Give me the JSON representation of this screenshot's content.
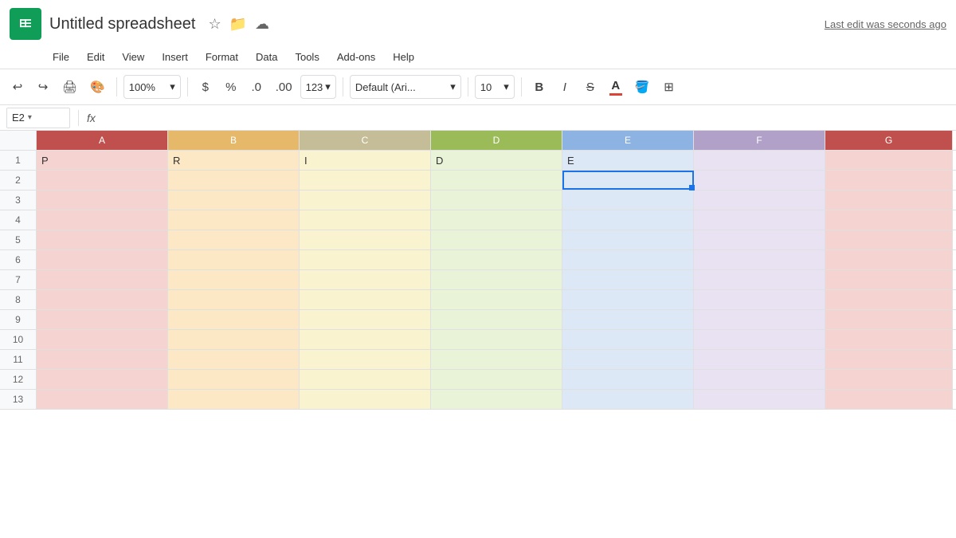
{
  "titleBar": {
    "title": "Untitled spreadsheet",
    "lastEdit": "Last edit was seconds ago"
  },
  "menu": {
    "items": [
      "File",
      "Edit",
      "View",
      "Insert",
      "Format",
      "Data",
      "Tools",
      "Add-ons",
      "Help"
    ]
  },
  "toolbar": {
    "zoom": "100%",
    "currency": "$",
    "percent": "%",
    "decimal0": ".0",
    "decimal00": ".00",
    "moreFormats": "123",
    "font": "Default (Ari...",
    "fontSize": "10",
    "bold": "B",
    "italic": "I",
    "strikethrough": "S",
    "underlineA": "A"
  },
  "formulaBar": {
    "cellRef": "E2",
    "fx": "fx"
  },
  "columns": [
    {
      "id": "A",
      "label": "A",
      "width": 165
    },
    {
      "id": "B",
      "label": "B",
      "width": 165
    },
    {
      "id": "C",
      "label": "C",
      "width": 165
    },
    {
      "id": "D",
      "label": "D",
      "width": 165
    },
    {
      "id": "E",
      "label": "E",
      "width": 165
    },
    {
      "id": "F",
      "label": "F",
      "width": 165
    },
    {
      "id": "G",
      "label": "G",
      "width": 160
    }
  ],
  "rows": [
    {
      "num": 1,
      "cells": [
        "P",
        "R",
        "I",
        "D",
        "E",
        "",
        ""
      ]
    },
    {
      "num": 2,
      "cells": [
        "",
        "",
        "",
        "",
        "",
        "",
        ""
      ]
    },
    {
      "num": 3,
      "cells": [
        "",
        "",
        "",
        "",
        "",
        "",
        ""
      ]
    },
    {
      "num": 4,
      "cells": [
        "",
        "",
        "",
        "",
        "",
        "",
        ""
      ]
    },
    {
      "num": 5,
      "cells": [
        "",
        "",
        "",
        "",
        "",
        "",
        ""
      ]
    },
    {
      "num": 6,
      "cells": [
        "",
        "",
        "",
        "",
        "",
        "",
        ""
      ]
    },
    {
      "num": 7,
      "cells": [
        "",
        "",
        "",
        "",
        "",
        "",
        ""
      ]
    },
    {
      "num": 8,
      "cells": [
        "",
        "",
        "",
        "",
        "",
        "",
        ""
      ]
    },
    {
      "num": 9,
      "cells": [
        "",
        "",
        "",
        "",
        "",
        "",
        ""
      ]
    },
    {
      "num": 10,
      "cells": [
        "",
        "",
        "",
        "",
        "",
        "",
        ""
      ]
    },
    {
      "num": 11,
      "cells": [
        "",
        "",
        "",
        "",
        "",
        "",
        ""
      ]
    },
    {
      "num": 12,
      "cells": [
        "",
        "",
        "",
        "",
        "",
        "",
        ""
      ]
    },
    {
      "num": 13,
      "cells": [
        "",
        "",
        "",
        "",
        "",
        "",
        ""
      ]
    }
  ],
  "activeCell": {
    "row": 2,
    "col": 4
  }
}
